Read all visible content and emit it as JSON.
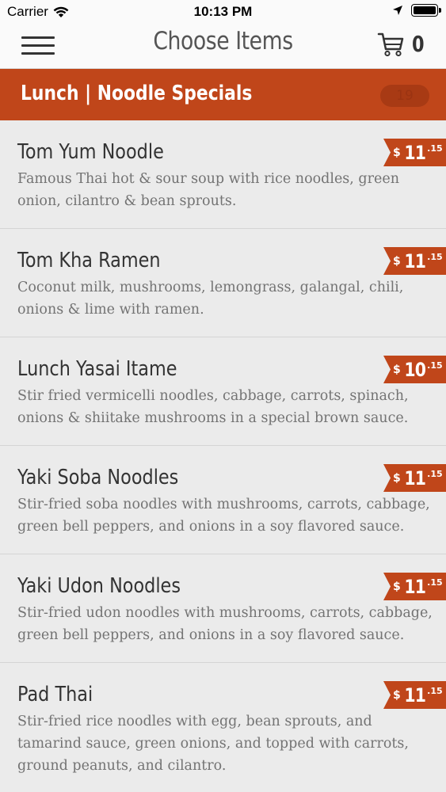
{
  "status_bar": {
    "carrier": "Carrier",
    "time": "10:13 PM"
  },
  "nav": {
    "title": "Choose Items",
    "cart_count": "0"
  },
  "section": {
    "title": "Lunch | Noodle Specials",
    "count": "19"
  },
  "colors": {
    "accent": "#c0461a",
    "background": "#ebebeb"
  },
  "items": [
    {
      "name": "Tom Yum Noodle",
      "description": "Famous Thai hot & sour soup with rice noodles, green onion, cilantro & bean sprouts.",
      "currency": "$",
      "price_main": "11",
      "price_cents": ".15"
    },
    {
      "name": "Tom Kha Ramen",
      "description": "Coconut milk, mushrooms, lemongrass, galangal, chili, onions & lime with ramen.",
      "currency": "$",
      "price_main": "11",
      "price_cents": ".15"
    },
    {
      "name": "Lunch Yasai Itame",
      "description": "Stir fried vermicelli noodles, cabbage, carrots, spinach, onions & shiitake mushrooms in a special brown sauce.",
      "currency": "$",
      "price_main": "10",
      "price_cents": ".15"
    },
    {
      "name": "Yaki Soba Noodles",
      "description": "Stir-fried soba noodles with mushrooms, carrots, cabbage, green bell peppers, and onions in a soy flavored sauce.",
      "currency": "$",
      "price_main": "11",
      "price_cents": ".15"
    },
    {
      "name": "Yaki Udon Noodles",
      "description": "Stir-fried udon noodles with mushrooms, carrots, cabbage, green bell peppers, and onions in a soy flavored sauce.",
      "currency": "$",
      "price_main": "11",
      "price_cents": ".15"
    },
    {
      "name": "Pad Thai",
      "description": "Stir-fried rice noodles with egg, bean sprouts, and tamarind sauce, green onions, and topped with carrots, ground peanuts, and cilantro.",
      "currency": "$",
      "price_main": "11",
      "price_cents": ".15"
    }
  ]
}
